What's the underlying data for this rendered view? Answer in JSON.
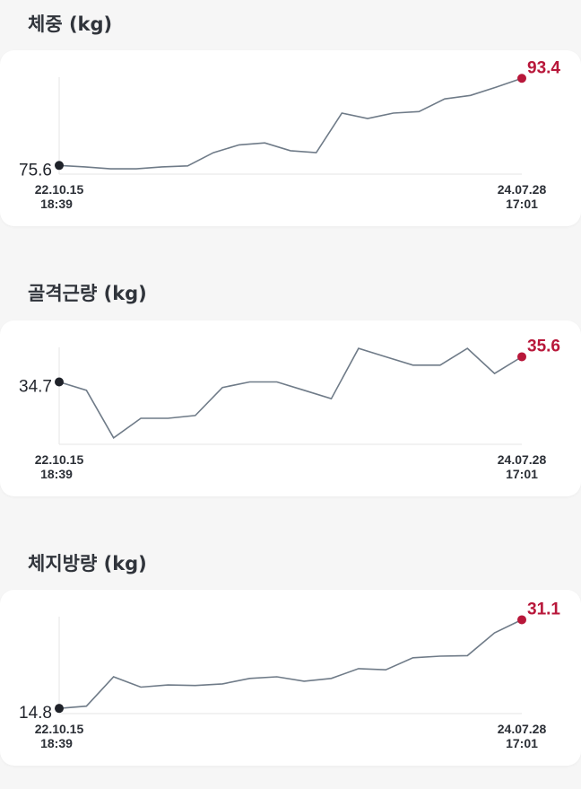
{
  "colors": {
    "line": "#6f7b88",
    "axis": "#e6e6e6",
    "start_dot": "#1f2229",
    "end_dot": "#b8173a"
  },
  "charts": [
    {
      "title": "체중 (kg)",
      "start_value": "75.6",
      "end_value": "93.4",
      "start_date": "22.10.15",
      "start_time": "18:39",
      "end_date": "24.07.28",
      "end_time": "17:01"
    },
    {
      "title": "골격근량 (kg)",
      "start_value": "34.7",
      "end_value": "35.6",
      "start_date": "22.10.15",
      "start_time": "18:39",
      "end_date": "24.07.28",
      "end_time": "17:01"
    },
    {
      "title": "체지방량 (kg)",
      "start_value": "14.8",
      "end_value": "31.1",
      "start_date": "22.10.15",
      "start_time": "18:39",
      "end_date": "24.07.28",
      "end_time": "17:01"
    }
  ],
  "chart_data": [
    {
      "type": "line",
      "title": "체중 (kg)",
      "x": [
        "22.10.15 18:39",
        "",
        "",
        "",
        "",
        "",
        "",
        "",
        "",
        "",
        "",
        "",
        "",
        "",
        "",
        "",
        "",
        "",
        "",
        "24.07.28 17:01"
      ],
      "series": [
        {
          "values": [
            75.6,
            75.3,
            74.9,
            74.9,
            75.3,
            75.5,
            78.2,
            79.8,
            80.2,
            78.6,
            78.2,
            86.3,
            85.2,
            86.3,
            86.6,
            89.2,
            89.9,
            91.6,
            93.4
          ]
        }
      ],
      "ylim": [
        74,
        94
      ]
    },
    {
      "type": "line",
      "title": "골격근량 (kg)",
      "x": [
        "22.10.15 18:39",
        "",
        "",
        "",
        "",
        "",
        "",
        "",
        "",
        "",
        "",
        "",
        "",
        "",
        "",
        "",
        "",
        "",
        "",
        "24.07.28 17:01"
      ],
      "series": [
        {
          "values": [
            34.7,
            34.4,
            32.7,
            33.4,
            33.4,
            33.5,
            34.5,
            34.7,
            34.7,
            34.4,
            34.1,
            35.9,
            35.6,
            35.3,
            35.3,
            35.9,
            35.0,
            35.6
          ]
        }
      ],
      "ylim": [
        32.5,
        36
      ]
    },
    {
      "type": "line",
      "title": "체지방량 (kg)",
      "x": [
        "22.10.15 18:39",
        "",
        "",
        "",
        "",
        "",
        "",
        "",
        "",
        "",
        "",
        "",
        "",
        "",
        "",
        "",
        "",
        "",
        "",
        "24.07.28 17:01"
      ],
      "series": [
        {
          "values": [
            14.8,
            15.2,
            20.6,
            18.7,
            19.1,
            19.0,
            19.3,
            20.3,
            20.6,
            19.8,
            20.3,
            22.1,
            21.9,
            24.1,
            24.4,
            24.5,
            28.7,
            31.1
          ]
        }
      ],
      "ylim": [
        14,
        32
      ]
    }
  ]
}
